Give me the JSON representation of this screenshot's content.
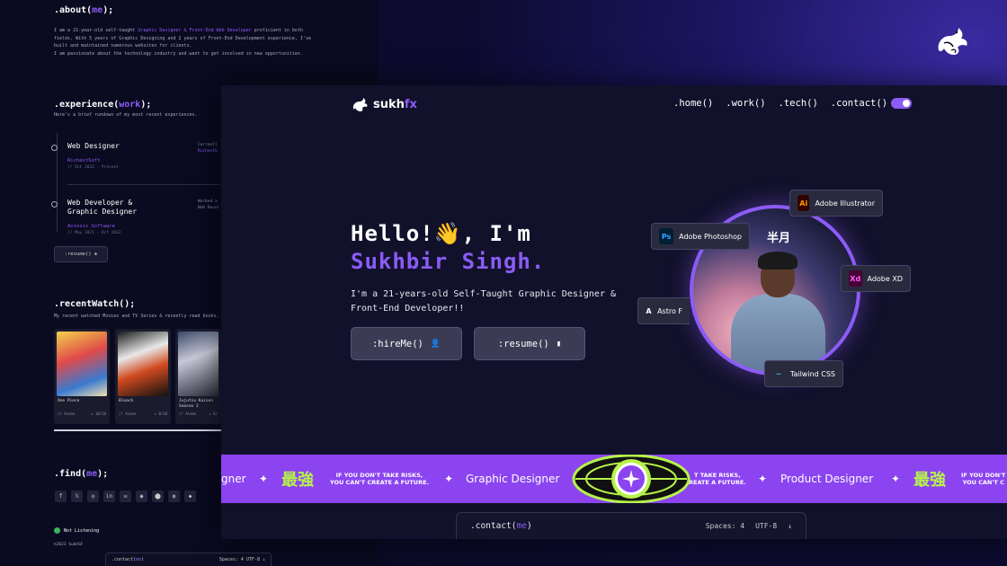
{
  "back": {
    "about": {
      "prefix": ".about(",
      "hl": "me",
      "suffix": ");"
    },
    "about_p1_a": "I am a 21-year-old self-taught ",
    "about_p1_hl": "Graphic Designer & Front-End Web Developer",
    "about_p1_b": " proficient in both fields. With 5 years of Graphic Designing and 2 years of Front-End Development experience, I've built and maintained numerous websites for clients.",
    "about_p2": "I am passionate about the technology industry and want to get involved in new opportunities.",
    "experience": {
      "prefix": ".experience(",
      "hl": "work",
      "suffix": ");"
    },
    "experience_sub": "Here's a brief rundown of my most recent experiences.",
    "jobs": [
      {
        "title": "Web Designer",
        "company": "RichestSoft",
        "date": "// Oct 2022 - Present",
        "side_a": "Currentl",
        "side_b": "RichestS"
      },
      {
        "title": "Web Developer & Graphic Designer",
        "company": "Aviosis Software",
        "date": "// May 2021 - Oct 2022",
        "side_a": "Worked a",
        "side_b": "Web Devel"
      }
    ],
    "resume_small": ":resume() ▪",
    "recent": {
      "prefix": ".recentWatch(",
      "hl": "",
      "suffix": ");"
    },
    "recent_sub": "My recent watched Movies and TV Series & recently read books.",
    "cards": [
      {
        "title": "One Piece",
        "type": "// Anime",
        "rating": "★ 10/10"
      },
      {
        "title": "Bleach",
        "type": "// Anime",
        "rating": "★ 8/10"
      },
      {
        "title": "Jujutsu Kaisen Season 2",
        "type": "// Anime",
        "rating": "★ 8/"
      }
    ],
    "find": {
      "prefix": ".find(",
      "hl": "me",
      "suffix": ");"
    },
    "socials": [
      "f",
      "𝕏",
      "◎",
      "in",
      "✉",
      "◉",
      "⬤",
      "◍",
      "◆"
    ],
    "spotify": "Not Listening",
    "copyright": "©2023 SukhSF",
    "mini_bar": {
      "prefix": ".contact(",
      "hl": "me",
      "suffix": ")",
      "meta": "Spaces: 4   UTF-8   ↓"
    }
  },
  "front": {
    "logo_a": "sukh",
    "logo_b": "fx",
    "nav": [
      ".home()",
      ".work()",
      ".tech()",
      ".contact()"
    ],
    "hello": "Hello!👋, I'm",
    "name": "Sukhbir Singh.",
    "bio": "I'm a 21-years-old Self-Taught Graphic Designer & Front-End Developer!!",
    "hire_label": ":hireMe()",
    "resume_label": ":resume()",
    "poster_text": "半月",
    "badges": [
      {
        "label": "Adobe Illustrator",
        "icon": "Ai"
      },
      {
        "label": "Adobe Photoshop",
        "icon": "Ps"
      },
      {
        "label": "Adobe XD",
        "icon": "Xd"
      },
      {
        "label": "Astro F",
        "icon": "A"
      },
      {
        "label": "Tailwind CSS",
        "icon": "~"
      }
    ],
    "ticker": {
      "item1": "gner",
      "kanji": "最強",
      "risk_1": "IF YOU DON'T TAKE RISKS,",
      "risk_2": "YOU CAN'T CREATE A FUTURE.",
      "graphic": "Graphic Designer",
      "risk_cut_1": "T TAKE RISKS,",
      "risk_cut_2": "REATE A FUTURE.",
      "product": "Product Designer",
      "risk_end_1": "IF YOU DON'T",
      "risk_end_2": "YOU CAN'T C"
    },
    "contact": {
      "prefix": ".contact(",
      "hl": "me",
      "suffix": ")",
      "spaces": "Spaces: 4",
      "enc": "UTF-8",
      "arrow": "↓"
    }
  },
  "colors": {
    "accent": "#8b5cf6",
    "ticker_bg": "#8b44f0",
    "ticker_green": "#b6f24a"
  }
}
